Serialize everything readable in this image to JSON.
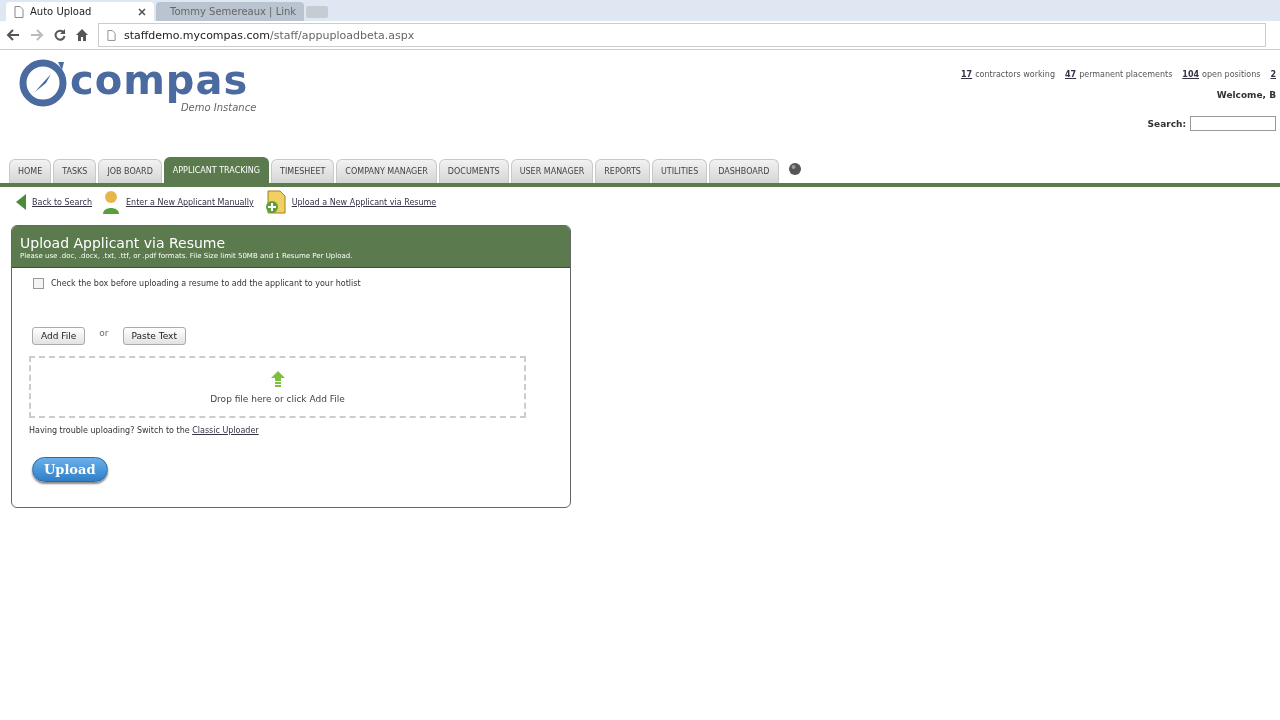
{
  "browser": {
    "tabs": [
      {
        "title": "Auto Upload",
        "selected": true,
        "kind": "page"
      },
      {
        "title": "Tommy Semereaux | Link",
        "selected": false,
        "kind": "linkedin"
      }
    ],
    "url": {
      "host": "staffdemo.mycompas.com",
      "path": "/staff/appuploadbeta.aspx"
    }
  },
  "header": {
    "logo": {
      "name": "compas",
      "subtitle": "Demo Instance"
    },
    "stats": [
      {
        "count": "17",
        "label": "contractors working"
      },
      {
        "count": "47",
        "label": "permanent placements"
      },
      {
        "count": "104",
        "label": "open positions"
      },
      {
        "count": "2"
      }
    ],
    "welcome": "Welcome, B",
    "search_label": "Search:"
  },
  "nav": [
    {
      "label": "HOME",
      "selected": false
    },
    {
      "label": "TASKS",
      "selected": false
    },
    {
      "label": "JOB BOARD",
      "selected": false
    },
    {
      "label": "APPLICANT TRACKING",
      "selected": true
    },
    {
      "label": "TIMESHEET",
      "selected": false
    },
    {
      "label": "COMPANY MANAGER",
      "selected": false
    },
    {
      "label": "DOCUMENTS",
      "selected": false
    },
    {
      "label": "USER MANAGER",
      "selected": false
    },
    {
      "label": "REPORTS",
      "selected": false
    },
    {
      "label": "UTILITIES",
      "selected": false
    },
    {
      "label": "DASHBOARD",
      "selected": false
    }
  ],
  "actions": [
    {
      "label": "Back to Search",
      "kind": "back"
    },
    {
      "label": "Enter a New Applicant Manually",
      "kind": "person"
    },
    {
      "label": "Upload a New Applicant via Resume",
      "kind": "resume"
    }
  ],
  "panel": {
    "title": "Upload Applicant via Resume",
    "subtitle": "Please use .doc, .docx, .txt, .ttf, or .pdf formats. File Size limit 50MB and 1 Resume Per Upload.",
    "hotlist": {
      "label": "Check the box before uploading a resume to add the applicant to your hotlist",
      "checked": false
    },
    "add_file": "Add File",
    "or": "or",
    "paste_text": "Paste Text",
    "drop_text": "Drop file here or click Add File",
    "trouble_text": "Having trouble uploading? Switch to the",
    "classic_link": "Classic Uploader",
    "upload": "Upload"
  }
}
